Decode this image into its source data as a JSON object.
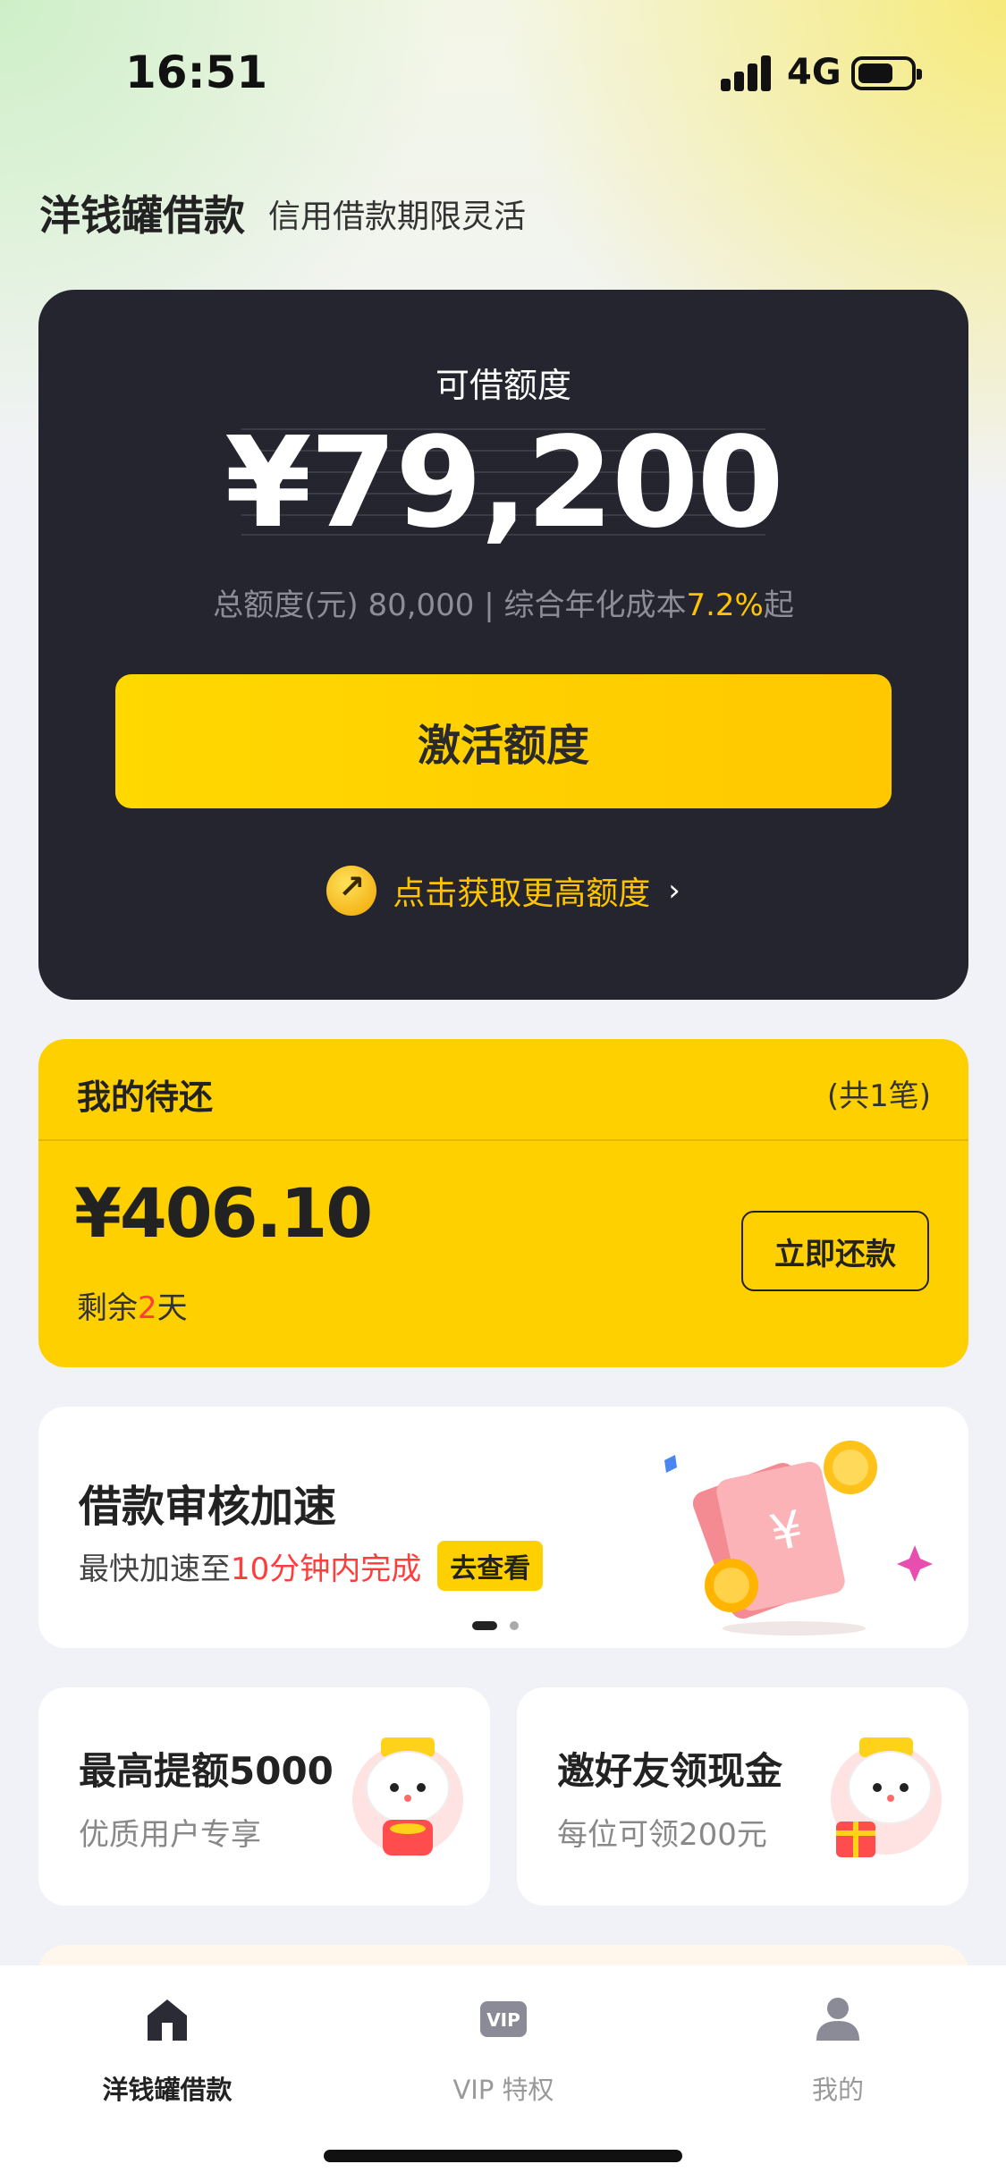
{
  "status_bar": {
    "time": "16:51",
    "network": "4G"
  },
  "header": {
    "brand": "洋钱罐借款",
    "slogan": "信用借款期限灵活"
  },
  "limit_card": {
    "label": "可借额度",
    "amount": "¥79,200",
    "sub_prefix": "总额度(元) 80,000 | 综合年化成本",
    "sub_rate": "7.2%",
    "sub_suffix": "起",
    "activate_label": "激活额度",
    "upgrade_text": "点击获取更高额度",
    "chevron": "›"
  },
  "repayment": {
    "title": "我的待还",
    "count": "(共1笔)",
    "amount": "¥406.10",
    "days_prefix": "剩余",
    "days_value": "2",
    "days_suffix": "天",
    "button_label": "立即还款"
  },
  "banner": {
    "title": "借款审核加速",
    "sub_prefix": "最快加速至",
    "sub_highlight": "10分钟内完成",
    "tag_label": "去查看"
  },
  "promos": [
    {
      "title": "最高提额5000",
      "subtitle": "优质用户专享"
    },
    {
      "title": "邀好友领现金",
      "subtitle": "每位可领200元"
    }
  ],
  "tabbar": {
    "items": [
      {
        "label": "洋钱罐借款",
        "icon": "home-icon"
      },
      {
        "label": "VIP 特权",
        "icon": "vip-icon"
      },
      {
        "label": "我的",
        "icon": "user-icon"
      }
    ],
    "vip_icon_text": "VIP"
  },
  "colors": {
    "accent_yellow": "#ffd000",
    "dark_card": "#24252e",
    "highlight_red": "#ff3d3d"
  }
}
